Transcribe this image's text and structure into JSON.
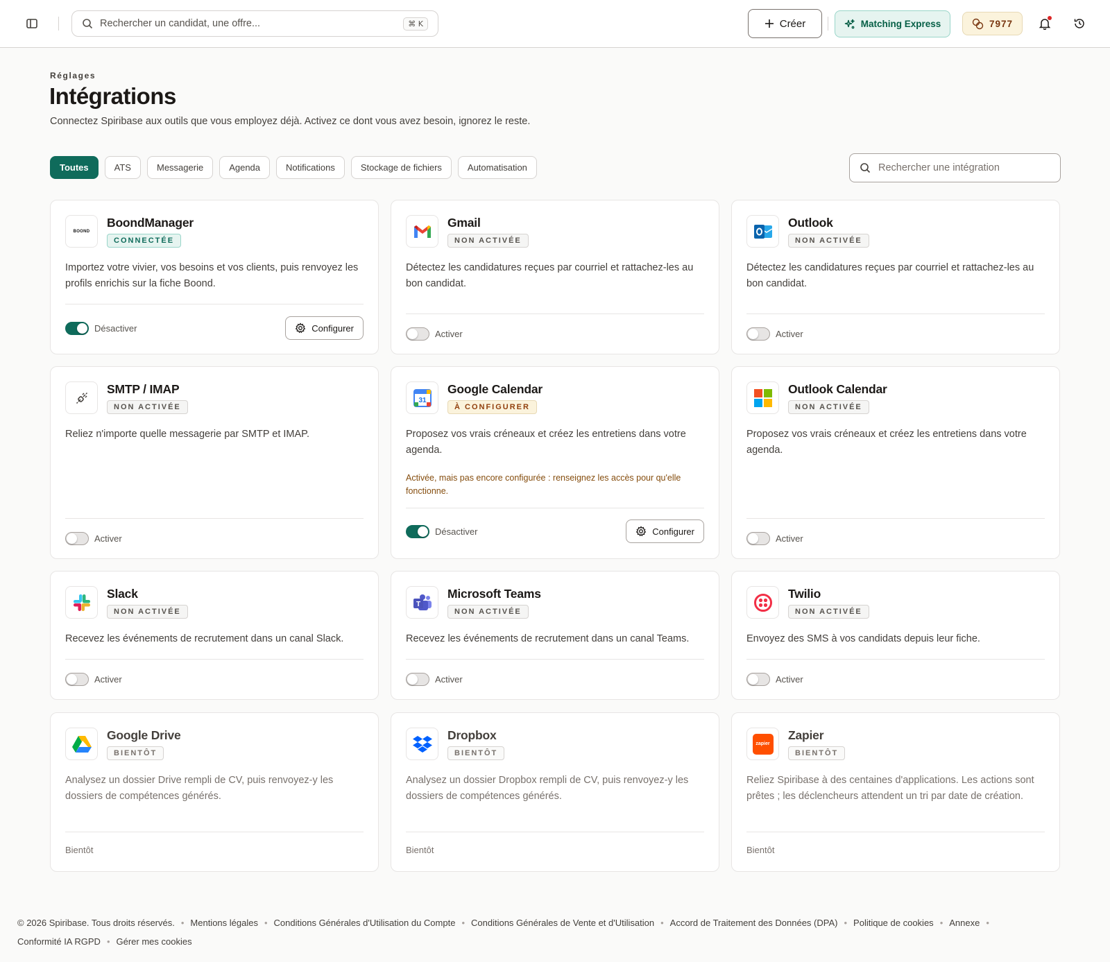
{
  "topbar": {
    "search_placeholder": "Rechercher un candidat, une offre...",
    "search_shortcut": "⌘ K",
    "create_label": "Créer",
    "matching_label": "Matching Express",
    "credits": "7977"
  },
  "header": {
    "eyebrow": "Réglages",
    "title": "Intégrations",
    "subtitle": "Connectez Spiribase aux outils que vous employez déjà. Activez ce dont vous avez besoin, ignorez le reste."
  },
  "filters": [
    "Toutes",
    "ATS",
    "Messagerie",
    "Agenda",
    "Notifications",
    "Stockage de fichiers",
    "Automatisation"
  ],
  "integration_search_placeholder": "Rechercher une intégration",
  "cards": [
    {
      "name": "BoondManager",
      "badge": "CONNECTÉE",
      "desc": "Importez votre vivier, vos besoins et vos clients, puis renvoyez les profils enrichis sur la fiche Boond.",
      "toggle_label": "Désactiver",
      "config_label": "Configurer",
      "logo_text": "BOOND"
    },
    {
      "name": "Gmail",
      "badge": "NON ACTIVÉE",
      "desc": "Détectez les candidatures reçues par courriel et rattachez-les au bon candidat.",
      "toggle_label": "Activer"
    },
    {
      "name": "Outlook",
      "badge": "NON ACTIVÉE",
      "desc": "Détectez les candidatures reçues par courriel et rattachez-les au bon candidat.",
      "toggle_label": "Activer"
    },
    {
      "name": "SMTP / IMAP",
      "badge": "NON ACTIVÉE",
      "desc": "Reliez n'importe quelle messagerie par SMTP et IMAP.",
      "toggle_label": "Activer"
    },
    {
      "name": "Google Calendar",
      "badge": "À CONFIGURER",
      "desc": "Proposez vos vrais créneaux et créez les entretiens dans votre agenda.",
      "warning": "Activée, mais pas encore configurée : renseignez les accès pour qu'elle fonctionne.",
      "toggle_label": "Désactiver",
      "config_label": "Configurer",
      "logo_text": "31"
    },
    {
      "name": "Outlook Calendar",
      "badge": "NON ACTIVÉE",
      "desc": "Proposez vos vrais créneaux et créez les entretiens dans votre agenda.",
      "toggle_label": "Activer"
    },
    {
      "name": "Slack",
      "badge": "NON ACTIVÉE",
      "desc": "Recevez les événements de recrutement dans un canal Slack.",
      "toggle_label": "Activer"
    },
    {
      "name": "Microsoft Teams",
      "badge": "NON ACTIVÉE",
      "desc": "Recevez les événements de recrutement dans un canal Teams.",
      "toggle_label": "Activer"
    },
    {
      "name": "Twilio",
      "badge": "NON ACTIVÉE",
      "desc": "Envoyez des SMS à vos candidats depuis leur fiche.",
      "toggle_label": "Activer"
    },
    {
      "name": "Google Drive",
      "badge": "BIENTÔT",
      "desc": "Analysez un dossier Drive rempli de CV, puis renvoyez-y les dossiers de compétences générés.",
      "toggle_label": "Bientôt"
    },
    {
      "name": "Dropbox",
      "badge": "BIENTÔT",
      "desc": "Analysez un dossier Dropbox rempli de CV, puis renvoyez-y les dossiers de compétences générés.",
      "toggle_label": "Bientôt"
    },
    {
      "name": "Zapier",
      "badge": "BIENTÔT",
      "desc": "Reliez Spiribase à des centaines d'applications. Les actions sont prêtes ; les déclencheurs attendent un tri par date de création.",
      "toggle_label": "Bientôt",
      "logo_text": "zapier"
    }
  ],
  "footer": {
    "copyright": "© 2026 Spiribase. Tous droits réservés.",
    "links": [
      "Mentions légales",
      "Conditions Générales d'Utilisation du Compte",
      "Conditions Générales de Vente et d'Utilisation",
      "Accord de Traitement des Données (DPA)",
      "Politique de cookies",
      "Annexe",
      "Conformité IA RGPD",
      "Gérer mes cookies"
    ]
  },
  "colors": {
    "accent": "#0f6b5b",
    "accent_soft": "#e6f4f0",
    "warning": "#854d0e",
    "notification_dot": "#dc2626"
  }
}
